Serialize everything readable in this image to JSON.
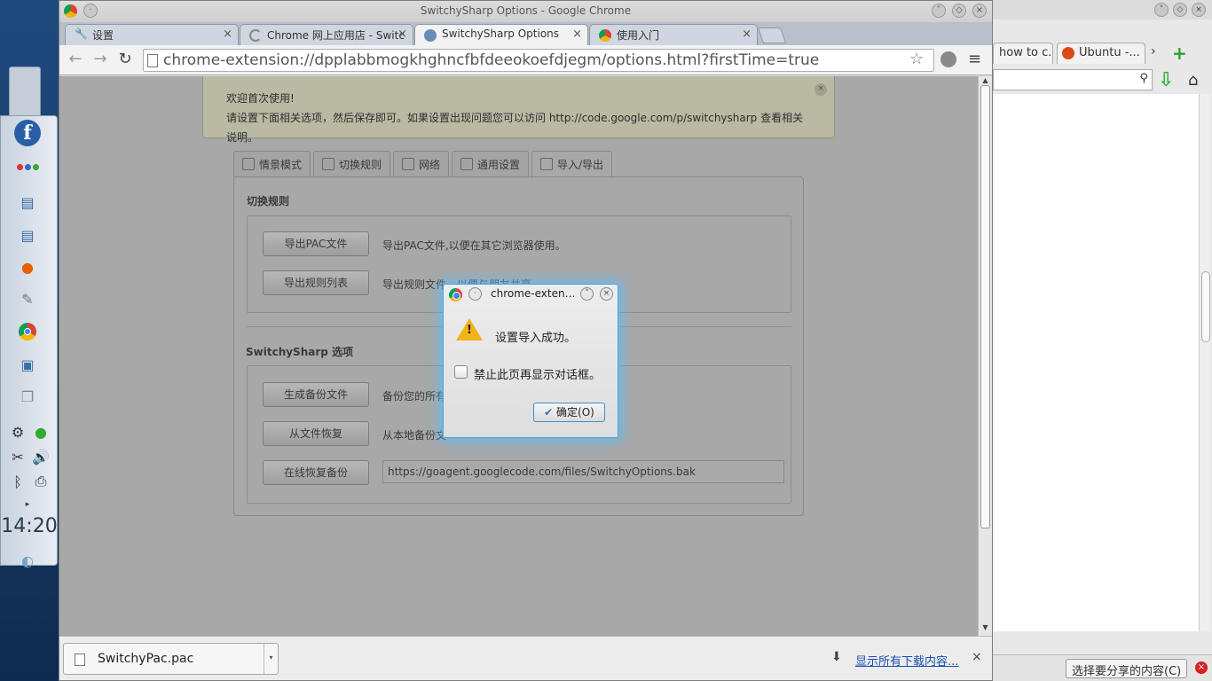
{
  "chrome": {
    "window_title": "SwitchySharp Options - Google Chrome",
    "tabs": [
      {
        "label": "设置",
        "active": false
      },
      {
        "label": "Chrome 网上应用店 - Switc",
        "active": false
      },
      {
        "label": "SwitchySharp Options",
        "active": true
      },
      {
        "label": "使用入门",
        "active": false
      }
    ],
    "url": "chrome-extension://dpplabbmogkhghncfbfdeeokoefdjegm/options.html?firstTime=true"
  },
  "notice": {
    "line1": "欢迎首次使用!",
    "line2": "请设置下面相关选项，然后保存即可。如果设置出现问题您可以访问 http://code.google.com/p/switchysharp 查看相关说明。"
  },
  "options_tabs": [
    {
      "label": "情景模式",
      "icon": "profile-icon"
    },
    {
      "label": "切换规则",
      "icon": "filter-icon"
    },
    {
      "label": "网络",
      "icon": "network-icon"
    },
    {
      "label": "通用设置",
      "icon": "gear-icon"
    },
    {
      "label": "导入/导出",
      "icon": "save-icon"
    }
  ],
  "rules_section": {
    "title": "切换规则",
    "export_pac_button": "导出PAC文件",
    "export_pac_desc": "导出PAC文件,以便在其它浏览器使用。",
    "export_rules_button": "导出规则列表",
    "export_rules_desc": "导出规则文件，以便与朋友共享。"
  },
  "options_section": {
    "title": "SwitchySharp 选项",
    "backup_button": "生成备份文件",
    "backup_desc": "备份您的所有",
    "restore_file_button": "从文件恢复",
    "restore_file_desc": "从本地备份文",
    "restore_online_button": "在线恢复备份",
    "restore_online_url": "https://goagent.googlecode.com/files/SwitchyOptions.bak"
  },
  "dialog": {
    "title": "chrome-exten…",
    "message": "设置导入成功。",
    "checkbox_label": "禁止此页再显示对话框。",
    "ok_label": "确定(O)"
  },
  "download_shelf": {
    "file_name": "SwitchyPac.pac",
    "show_all": "显示所有下载内容..."
  },
  "background_window": {
    "tab1": "how to c...",
    "tab2": "Ubuntu -...",
    "share_button": "选择要分享的内容(C)"
  },
  "panel": {
    "clock": "14:20"
  }
}
